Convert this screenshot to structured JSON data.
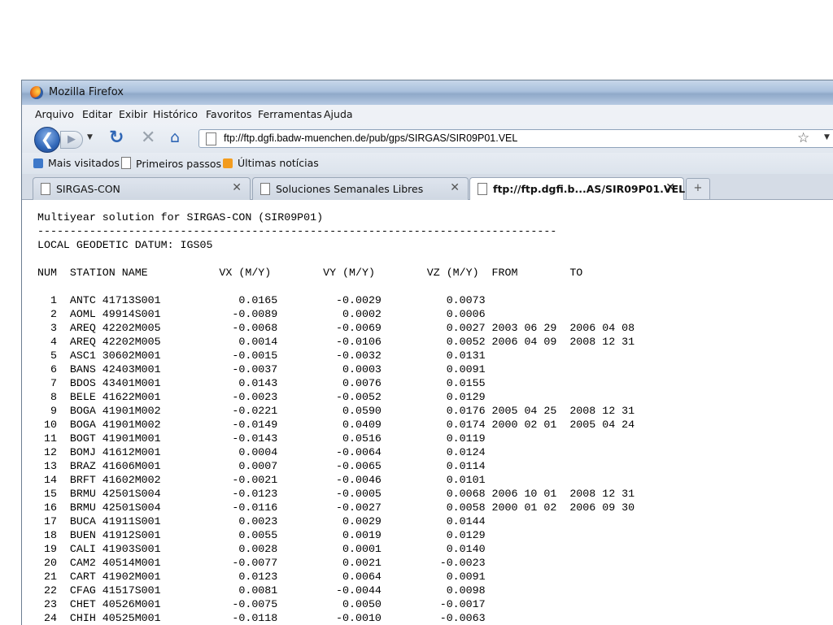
{
  "window": {
    "title": "Mozilla Firefox"
  },
  "menu": [
    "Arquivo",
    "Editar",
    "Exibir",
    "Histórico",
    "Favoritos",
    "Ferramentas",
    "Ajuda"
  ],
  "url": "ftp://ftp.dgfi.badw-muenchen.de/pub/gps/SIRGAS/SIR09P01.VEL",
  "bookmarks": [
    "Mais visitados",
    "Primeiros passos",
    "Últimas notícias"
  ],
  "tabs": [
    {
      "label": "SIRGAS-CON",
      "active": false
    },
    {
      "label": "Soluciones Semanales Libres",
      "active": false
    },
    {
      "label": "ftp://ftp.dgfi.b...AS/SIR09P01.VEL",
      "active": true
    }
  ],
  "file": {
    "title": "Multiyear solution for SIRGAS-CON (SIR09P01)",
    "separator": "--------------------------------------------------------------------------------",
    "datum": "LOCAL GEODETIC DATUM: IGS05",
    "header": "NUM  STATION NAME           VX (M/Y)        VY (M/Y)        VZ (M/Y)  FROM        TO",
    "rows": [
      "  1  ANTC 41713S001            0.0165         -0.0029          0.0073",
      "  2  AOML 49914S001           -0.0089          0.0002          0.0006",
      "  3  AREQ 42202M005           -0.0068         -0.0069          0.0027 2003 06 29  2006 04 08",
      "  4  AREQ 42202M005            0.0014         -0.0106          0.0052 2006 04 09  2008 12 31",
      "  5  ASC1 30602M001           -0.0015         -0.0032          0.0131",
      "  6  BANS 42403M001           -0.0037          0.0003          0.0091",
      "  7  BDOS 43401M001            0.0143          0.0076          0.0155",
      "  8  BELE 41622M001           -0.0023         -0.0052          0.0129",
      "  9  BOGA 41901M002           -0.0221          0.0590          0.0176 2005 04 25  2008 12 31",
      " 10  BOGA 41901M002           -0.0149          0.0409          0.0174 2000 02 01  2005 04 24",
      " 11  BOGT 41901M001           -0.0143          0.0516          0.0119",
      " 12  BOMJ 41612M001            0.0004         -0.0064          0.0124",
      " 13  BRAZ 41606M001            0.0007         -0.0065          0.0114",
      " 14  BRFT 41602M002           -0.0021         -0.0046          0.0101",
      " 15  BRMU 42501S004           -0.0123         -0.0005          0.0068 2006 10 01  2008 12 31",
      " 16  BRMU 42501S004           -0.0116         -0.0027          0.0058 2000 01 02  2006 09 30",
      " 17  BUCA 41911S001            0.0023          0.0029          0.0144",
      " 18  BUEN 41912S001            0.0055          0.0019          0.0129",
      " 19  CALI 41903S001            0.0028          0.0001          0.0140",
      " 20  CAM2 40514M001           -0.0077          0.0021         -0.0023",
      " 21  CART 41902M001            0.0123          0.0064          0.0091",
      " 22  CFAG 41517S001            0.0081         -0.0044          0.0098",
      " 23  CHET 40526M001           -0.0075          0.0050         -0.0017",
      " 24  CHIH 40525M001           -0.0118         -0.0010         -0.0063"
    ]
  }
}
